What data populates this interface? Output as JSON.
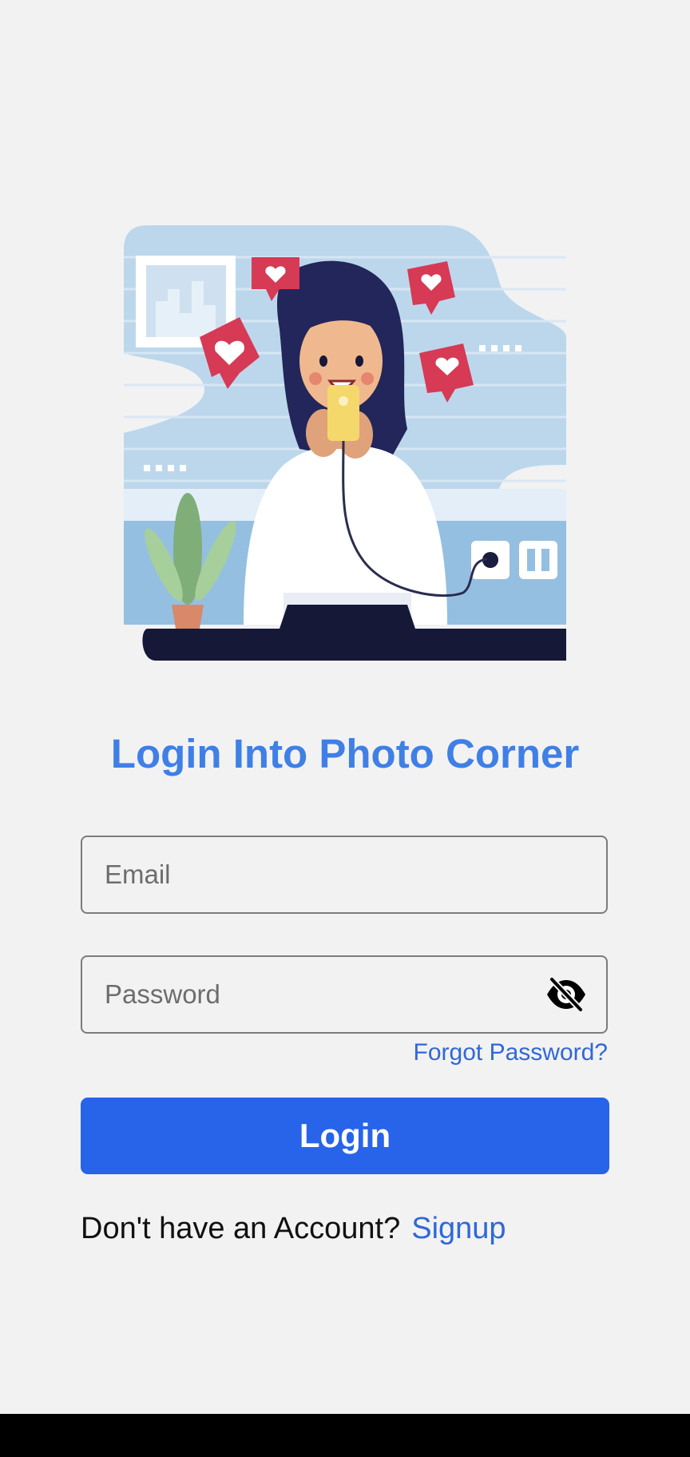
{
  "login": {
    "title": "Login Into Photo Corner",
    "email": {
      "placeholder": "Email",
      "value": ""
    },
    "password": {
      "placeholder": "Password",
      "value": "",
      "visibility_icon": "eye-off-icon"
    },
    "forgot_password_label": "Forgot Password?",
    "login_button_label": "Login",
    "signup_prompt": "Don't have an Account?",
    "signup_link_label": "Signup"
  },
  "colors": {
    "background": "#f2f2f3",
    "title": "#3f7fe6",
    "link": "#2f68d8",
    "button": "#2764ea",
    "button_text": "#ffffff",
    "field_border": "#7c7c7c",
    "nav_bar": "#000000"
  },
  "illustration": {
    "subject": "woman-taking-selfie-with-heart-reactions"
  }
}
